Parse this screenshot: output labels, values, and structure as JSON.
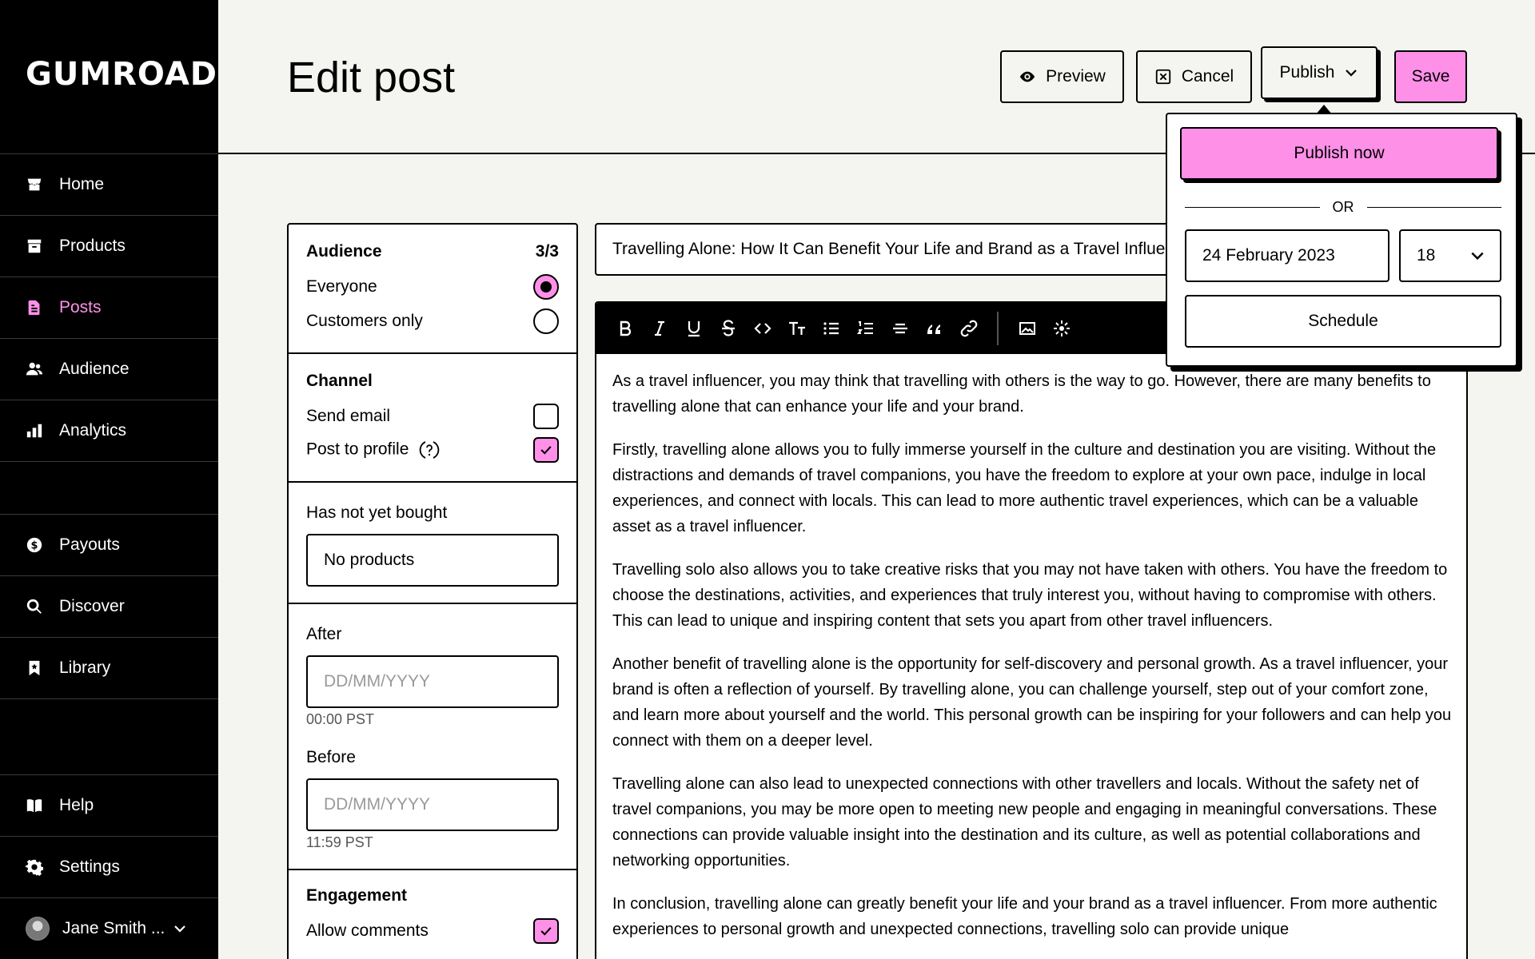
{
  "sidebar": {
    "logo": "GUMROAD",
    "items": [
      {
        "label": "Home",
        "icon": "store-icon"
      },
      {
        "label": "Products",
        "icon": "archive-icon"
      },
      {
        "label": "Posts",
        "icon": "file-text-icon"
      },
      {
        "label": "Audience",
        "icon": "people-icon"
      },
      {
        "label": "Analytics",
        "icon": "bar-chart-icon"
      },
      {
        "label": "Payouts",
        "icon": "dollar-icon"
      },
      {
        "label": "Discover",
        "icon": "search-icon"
      },
      {
        "label": "Library",
        "icon": "bookmark-icon"
      },
      {
        "label": "Help",
        "icon": "book-icon"
      },
      {
        "label": "Settings",
        "icon": "gear-icon"
      }
    ],
    "active": "Posts",
    "user": {
      "name": "Jane Smith ..."
    }
  },
  "header": {
    "title": "Edit post",
    "preview_label": "Preview",
    "cancel_label": "Cancel",
    "publish_label": "Publish",
    "save_label": "Save"
  },
  "publish_menu": {
    "publish_now_label": "Publish now",
    "or_label": "OR",
    "date_value": "24 February 2023",
    "hour_value": "18",
    "schedule_label": "Schedule"
  },
  "settings": {
    "audience": {
      "heading": "Audience",
      "count": "3/3",
      "options": [
        {
          "label": "Everyone",
          "selected": true
        },
        {
          "label": "Customers only",
          "selected": false
        }
      ]
    },
    "channel": {
      "heading": "Channel",
      "send_email_label": "Send email",
      "send_email_checked": false,
      "post_to_profile_label": "Post to profile",
      "post_to_profile_checked": true
    },
    "not_bought": {
      "label": "Has not yet bought",
      "value": "No products"
    },
    "after": {
      "label": "After",
      "placeholder": "DD/MM/YYYY",
      "time_hint": "00:00 PST"
    },
    "before": {
      "label": "Before",
      "placeholder": "DD/MM/YYYY",
      "time_hint": "11:59 PST"
    },
    "engagement": {
      "heading": "Engagement",
      "allow_comments_label": "Allow comments",
      "allow_comments_checked": true
    }
  },
  "editor": {
    "title": "Travelling Alone: How It Can Benefit Your Life and Brand as a Travel Influencer",
    "toolbar": [
      "bold-icon",
      "italic-icon",
      "underline-icon",
      "strikethrough-icon",
      "code-icon",
      "text-size-icon",
      "bullet-list-icon",
      "numbered-list-icon",
      "horizontal-rule-icon",
      "quote-icon",
      "link-icon",
      "image-icon",
      "embed-icon"
    ],
    "paragraphs": [
      "As a travel influencer, you may think that travelling with others is the way to go. However, there are many benefits to travelling alone that can enhance your life and your brand.",
      "Firstly, travelling alone allows you to fully immerse yourself in the culture and destination you are visiting. Without the distractions and demands of travel companions, you have the freedom to explore at your own pace, indulge in local experiences, and connect with locals. This can lead to more authentic travel experiences, which can be a valuable asset as a travel influencer.",
      "Travelling solo also allows you to take creative risks that you may not have taken with others. You have the freedom to choose the destinations, activities, and experiences that truly interest you, without having to compromise with others. This can lead to unique and inspiring content that sets you apart from other travel influencers.",
      "Another benefit of travelling alone is the opportunity for self-discovery and personal growth. As a travel influencer, your brand is often a reflection of yourself. By travelling alone, you can challenge yourself, step out of your comfort zone, and learn more about yourself and the world. This personal growth can be inspiring for your followers and can help you connect with them on a deeper level.",
      "Travelling alone can also lead to unexpected connections with other travellers and locals. Without the safety net of travel companions, you may be more open to meeting new people and engaging in meaningful conversations. These connections can provide valuable insight into the destination and its culture, as well as potential collaborations and networking opportunities.",
      "In conclusion, travelling alone can greatly benefit your life and your brand as a travel influencer. From more authentic experiences to personal growth and unexpected connections, travelling solo can provide unique"
    ]
  },
  "colors": {
    "accent": "#ff90e8",
    "sidebar_bg": "#000000",
    "page_bg": "#f4f4f0"
  }
}
